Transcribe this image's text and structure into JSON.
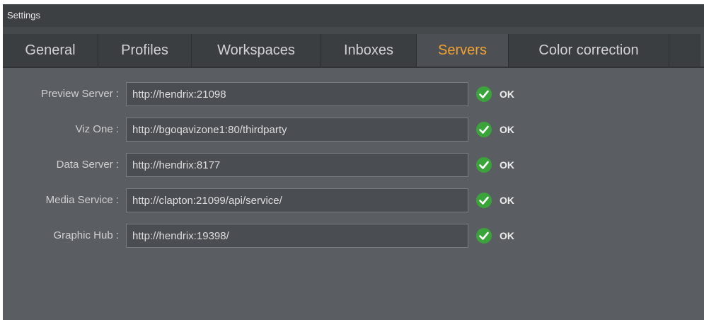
{
  "window": {
    "title": "Settings"
  },
  "tabs": [
    {
      "label": "General",
      "active": false
    },
    {
      "label": "Profiles",
      "active": false
    },
    {
      "label": "Workspaces",
      "active": false
    },
    {
      "label": "Inboxes",
      "active": false
    },
    {
      "label": "Servers",
      "active": true
    },
    {
      "label": "Color correction",
      "active": false
    }
  ],
  "servers": [
    {
      "label": "Preview Server :",
      "value": "http://hendrix:21098",
      "status": "OK",
      "status_icon": "check-circle-icon"
    },
    {
      "label": "Viz One :",
      "value": "http://bgoqavizone1:80/thirdparty",
      "status": "OK",
      "status_icon": "check-circle-icon"
    },
    {
      "label": "Data Server :",
      "value": "http://hendrix:8177",
      "status": "OK",
      "status_icon": "check-circle-icon"
    },
    {
      "label": "Media Service :",
      "value": "http://clapton:21099/api/service/",
      "status": "OK",
      "status_icon": "check-circle-icon"
    },
    {
      "label": "Graphic Hub :",
      "value": "http://hendrix:19398/",
      "status": "OK",
      "status_icon": "check-circle-icon"
    }
  ],
  "colors": {
    "accent": "#f0a030",
    "ok_green": "#3aa33a",
    "panel_bg": "#5a5e62",
    "tabbar_bg": "#3b3e41"
  }
}
